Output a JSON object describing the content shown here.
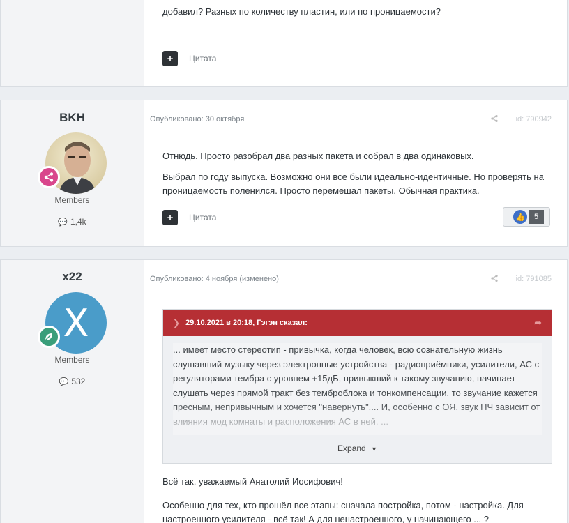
{
  "post1": {
    "text_tail": "добавил? Разных по количеству пластин, или по проницаемости?",
    "quote_label": "Цитата"
  },
  "post2": {
    "author": "BKH",
    "group": "Members",
    "post_count": "1,4k",
    "published": "Опубликовано: 30 октября",
    "post_id": "id: 790942",
    "paragraphs": [
      "Отнюдь. Просто разобрал два разных пакета и собрал в два одинаковых.",
      "Выбрал по году выпуска. Возможно они все были идеально-идентичные. Но проверять  на проницаемость поленился. Просто перемешал пакеты. Обычная практика."
    ],
    "quote_label": "Цитата",
    "reaction_count": "5",
    "badge_color": "#d9468c"
  },
  "post3": {
    "author": "x22",
    "avatar_letter": "X",
    "group": "Members",
    "post_count": "532",
    "published": "Опубликовано: 4 ноября (изменено)",
    "post_id": "id: 791085",
    "badge_color": "#3a9e7a",
    "avatar_color": "#4a9cc9",
    "quote": {
      "header": "29.10.2021 в 20:18, Гэгэн сказал:",
      "text": "... имеет место стереотип - привычка, когда человек, всю сознательную жизнь слушавший музыку через электронные устройства - радиоприёмники, усилители, АС с регуляторами тембра с уровнем  +15дБ, привыкший к такому звучанию, начинает слушать  через   прямой  тракт без темброблока и тонкомпенсации, то звучание кажется пресным, непривычным и хочется \"навернуть\"....  И, особенно с ОЯ,  звук НЧ зависит от  влияния мод комнаты и расположения АС в ней.  ...",
      "expand": "Expand"
    },
    "paragraphs": [
      "Всё так, уважаемый Анатолий Иосифович!",
      "Особенно для тех, кто прошёл все этапы: сначала постройка, потом - настройка. Для настроенного усилителя - всё так! А для ненастроенного, у начинающего ... ?"
    ]
  }
}
